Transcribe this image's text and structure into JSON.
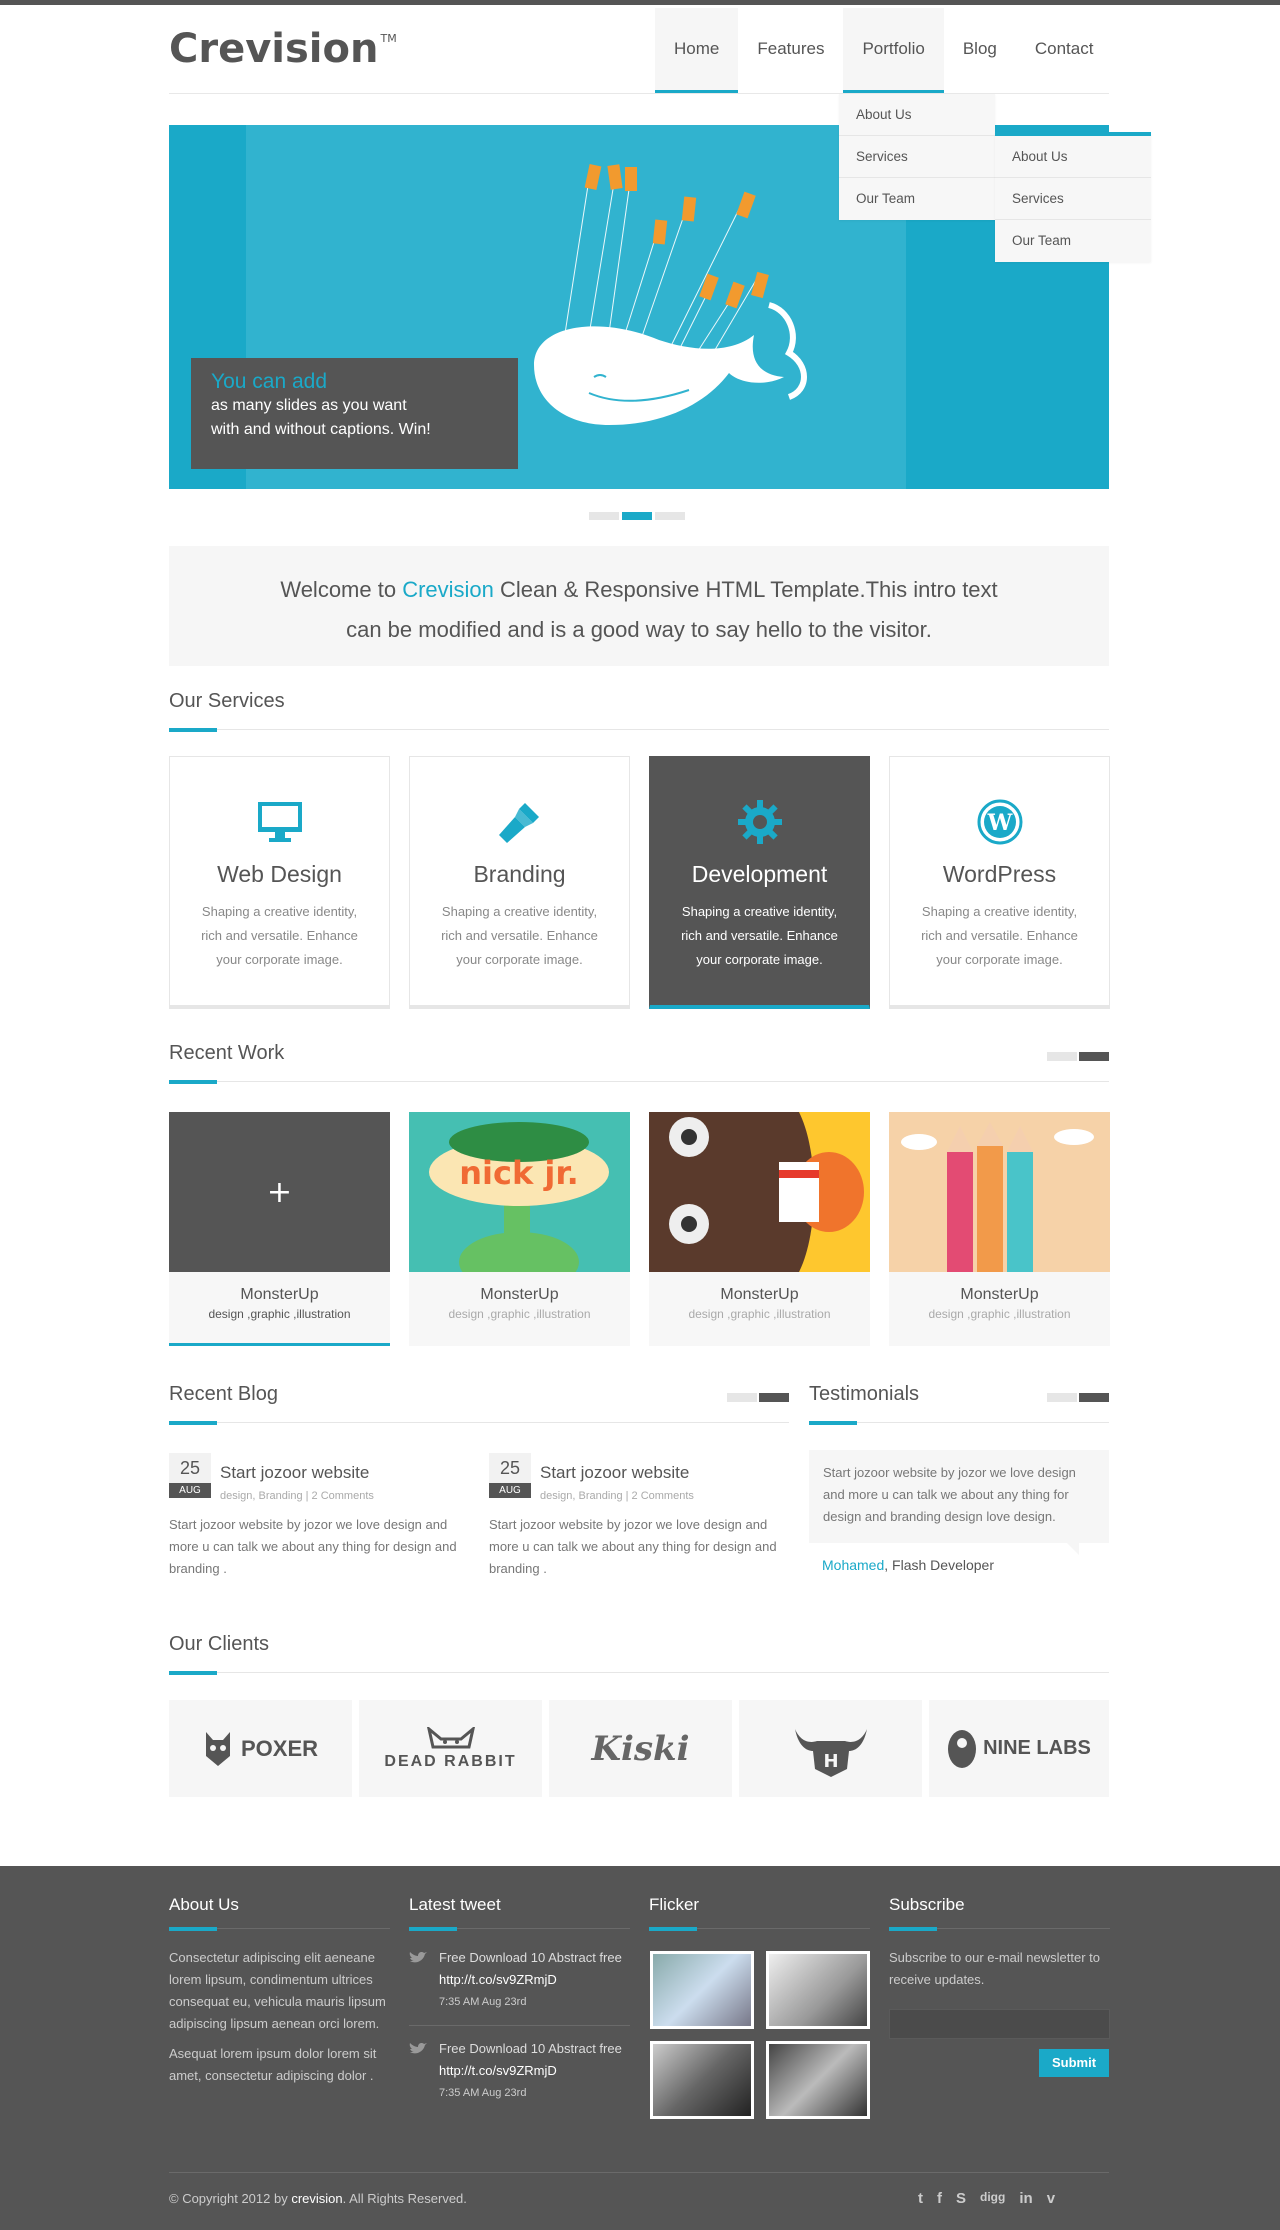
{
  "header": {
    "logo": "Crevision",
    "logo_tm": "TM",
    "nav": [
      "Home",
      "Features",
      "Portfolio",
      "Blog",
      "Contact"
    ]
  },
  "dropdown_portfolio": [
    "About Us",
    "Services",
    "Our Team"
  ],
  "dropdown_sub": [
    "About Us",
    "Services",
    "Our Team"
  ],
  "slider": {
    "caption_title": "You can add",
    "caption_line1": "as many slides as you want",
    "caption_line2": "with and without captions. Win!"
  },
  "intro": {
    "pre": "Welcome to ",
    "brand": "Crevision",
    "line1_rest": " Clean & Responsive HTML Template.This intro text",
    "line2": "can be modified and is a good way to say hello to the visitor."
  },
  "services": {
    "title": "Our Services",
    "items": [
      {
        "name": "Web Design",
        "icon": "monitor-icon",
        "desc": "Shaping a creative identity, rich and versatile. Enhance your corporate image."
      },
      {
        "name": "Branding",
        "icon": "brush-icon",
        "desc": "Shaping a creative identity, rich and versatile. Enhance your corporate image."
      },
      {
        "name": "Development",
        "icon": "gear-icon",
        "desc": "Shaping a creative identity, rich and versatile. Enhance your corporate image."
      },
      {
        "name": "WordPress",
        "icon": "wordpress-icon",
        "desc": "Shaping a creative identity, rich and versatile. Enhance your corporate image."
      }
    ]
  },
  "recent_work": {
    "title": "Recent Work",
    "items": [
      {
        "title": "MonsterUp",
        "tags": "design ,graphic ,illustration"
      },
      {
        "title": "MonsterUp",
        "tags": "design ,graphic ,illustration"
      },
      {
        "title": "MonsterUp",
        "tags": "design ,graphic ,illustration"
      },
      {
        "title": "MonsterUp",
        "tags": "design ,graphic ,illustration"
      }
    ],
    "hover_plus": "+",
    "nick_label": "nick jr."
  },
  "blog": {
    "title": "Recent Blog",
    "posts": [
      {
        "day": "25",
        "month": "AUG",
        "title": "Start jozoor website",
        "meta": "design, Branding | 2 Comments",
        "body": "Start jozoor website by jozor we love design and more u can talk we about any thing for design and branding ."
      },
      {
        "day": "25",
        "month": "AUG",
        "title": "Start jozoor website",
        "meta": "design, Branding | 2 Comments",
        "body": "Start jozoor website by jozor we love design and more u can talk we about any thing for design and branding ."
      }
    ]
  },
  "testimonials": {
    "title": "Testimonials",
    "quote": "Start jozoor website by jozor we love design and more u can talk we about any thing for design and branding design love design.",
    "author": "Mohamed",
    "role": ", Flash Developer"
  },
  "clients": {
    "title": "Our Clients",
    "logos": [
      "POXER",
      "DEAD RABBIT",
      "Kiski",
      "H",
      "NINE LABS"
    ]
  },
  "footer": {
    "about_title": "About Us",
    "about_p1": "Consectetur adipiscing elit aeneane lorem lipsum, condimentum ultrices consequat eu, vehicula mauris lipsum adipiscing lipsum aenean orci lorem.",
    "about_p2": "Asequat lorem ipsum dolor lorem sit amet, consectetur adipiscing dolor .",
    "tweet_title": "Latest tweet",
    "tweets": [
      {
        "text": "Free Download 10 Abstract free",
        "link": "http://t.co/sv9ZRmjD",
        "time": "7:35 AM Aug 23rd"
      },
      {
        "text": "Free Download 10 Abstract free",
        "link": "http://t.co/sv9ZRmjD",
        "time": "7:35 AM Aug 23rd"
      }
    ],
    "flicker_title": "Flicker",
    "subscribe_title": "Subscribe",
    "subscribe_text": "Subscribe to our e-mail newsletter to receive updates.",
    "subscribe_button": "Submit",
    "copyright_pre": "© Copyright 2012 by ",
    "copyright_brand": "crevision",
    "copyright_post": ". All Rights Reserved.",
    "social": [
      "twitter-icon",
      "facebook-icon",
      "skype-icon",
      "digg-icon",
      "linkedin-icon",
      "vimeo-icon"
    ],
    "social_labels": [
      "t",
      "f",
      "S",
      "digg",
      "in",
      "v"
    ]
  },
  "colors": {
    "accent": "#1aa9c8",
    "dark": "#555555",
    "light": "#f6f6f6"
  }
}
